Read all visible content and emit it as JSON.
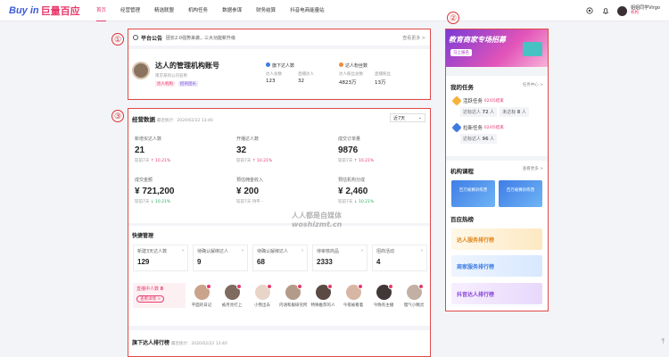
{
  "header": {
    "logo_a": "Buy in",
    "logo_b": "巨量百应",
    "nav": [
      "首页",
      "经营管理",
      "精选联盟",
      "机构任务",
      "数据参谋",
      "财务结算",
      "抖音电商能量站"
    ],
    "user_name": "姐姐同学Virgo",
    "user_tag": "机构"
  },
  "annotations": {
    "n1": "①",
    "n2": "②",
    "n3": "③"
  },
  "platform": {
    "title": "平台公告",
    "notice": "团长2.0强势来袭，三大功能新升级",
    "more": "查看更多 >"
  },
  "account": {
    "name": "达人的管理机构账号",
    "company": "南京某的公司名称",
    "tags": [
      "达人机构",
      "招商团长"
    ],
    "stat1": {
      "label": "旗下达人数",
      "col1": "达人总数",
      "col2": "直播达人",
      "v1": "123",
      "v2": "32"
    },
    "stat2": {
      "label": "达人粉丝数",
      "col1": "达人粉丝总数",
      "col2": "直播粉丝",
      "v1": "4823万",
      "v2": "13万"
    }
  },
  "ops": {
    "title": "经营数据",
    "updated": "最近统计：2020/02/22 13:40",
    "range": "近7天",
    "metrics": [
      {
        "label": "新增买达人数",
        "value": "21",
        "cmp": "较前7天",
        "chg": "↑ 10.21%",
        "pos": "up"
      },
      {
        "label": "开播达人数",
        "value": "32",
        "cmp": "较前7天",
        "chg": "↑ 10.21%",
        "pos": "up"
      },
      {
        "label": "成交订单量",
        "value": "9876",
        "cmp": "较前7天",
        "chg": "↑ 10.21%",
        "pos": "up"
      },
      {
        "label": "成交金额",
        "value": "¥ 721,200",
        "cmp": "较前7天",
        "chg": "↓ 10.21%",
        "pos": "down"
      },
      {
        "label": "预估佣金收入",
        "value": "¥ 200",
        "cmp": "较前7天",
        "chg": "持平 -",
        "pos": "flat"
      },
      {
        "label": "预估机构分成",
        "value": "¥ 2,460",
        "cmp": "较前7天",
        "chg": "↓ 10.21%",
        "pos": "down"
      }
    ]
  },
  "quick": {
    "title": "快捷管理",
    "items": [
      {
        "label": "新建3天达人数",
        "value": "129"
      },
      {
        "label": "待确认解绑达人",
        "value": "9"
      },
      {
        "label": "待确认解绑达人",
        "value": "68"
      },
      {
        "label": "待审核商品",
        "value": "2333"
      },
      {
        "label": "招商活动",
        "value": "4"
      }
    ]
  },
  "live": {
    "label": "直播中人数",
    "count": "8",
    "btn": "查看详情 >",
    "streamers": [
      "平面的日记",
      "被月亮打上",
      "小熊出去",
      "内涵和服研究所",
      "特殊推荐的人",
      "今夜被看着",
      "今晚有主播",
      "慢气小精灵"
    ]
  },
  "bottom": {
    "title": "旗下达人排行榜",
    "updated": "最近统计：2020/02/22 13:40"
  },
  "banner": {
    "title": "教育商家专场招募",
    "btn": "马上报名"
  },
  "tasks": {
    "title": "我的任务",
    "center": "任务中心 >",
    "t1": {
      "name": "活跃任务",
      "date": "02/05结束",
      "chip1": "达标达人",
      "v1": "72",
      "u1": "人",
      "chip2": "未达标",
      "v2": "8",
      "u2": "人"
    },
    "t2": {
      "name": "拉新任务",
      "date": "02/05结束",
      "chip1": "达标达人",
      "v1": "96",
      "u1": "人"
    }
  },
  "courses": {
    "title": "机构课程",
    "more": "查看更多 >",
    "c1": "百万被赛训练营",
    "c2": "百万被赛训练营"
  },
  "hot": {
    "title": "百应热榜",
    "r1": "达人服务排行榜",
    "r2": "商家服务排行榜",
    "r3": "抖音达人排行榜"
  },
  "watermark": {
    "line1": "人人都是自媒体",
    "line2": "woshizmt.cn"
  },
  "colors": {
    "accent": "#e8396c",
    "brand": "#3d5bd9",
    "annot": "#e04848"
  }
}
